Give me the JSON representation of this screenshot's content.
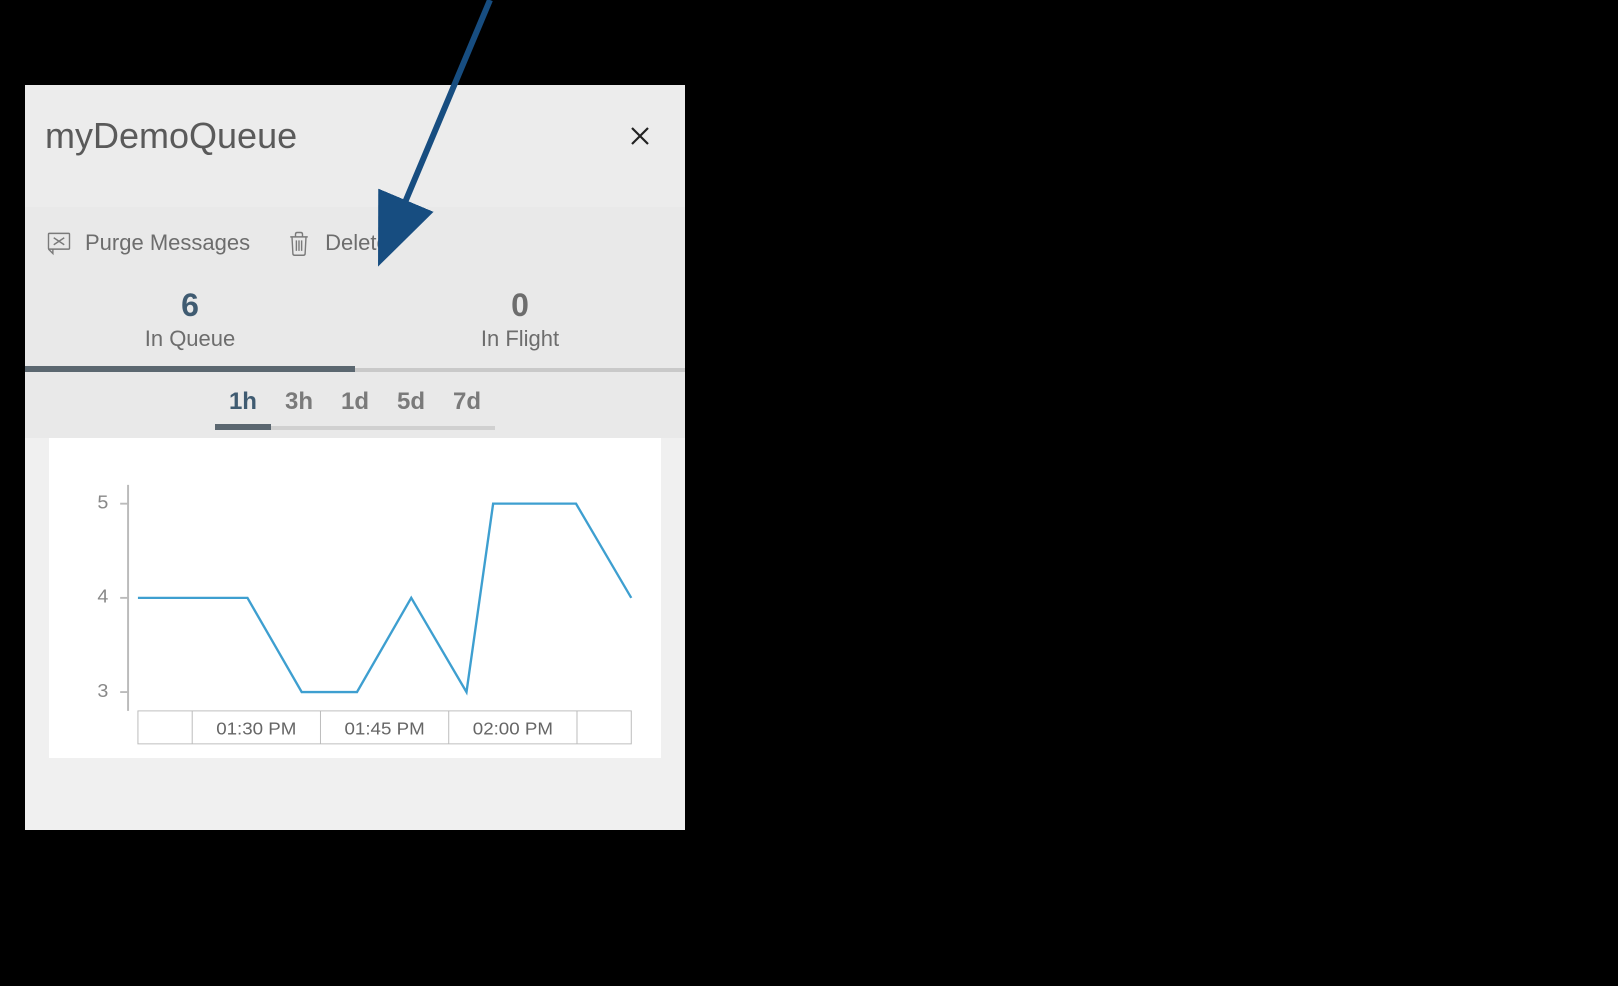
{
  "header": {
    "title": "myDemoQueue"
  },
  "actions": {
    "purge_label": "Purge Messages",
    "delete_label": "Delete"
  },
  "metrics": {
    "in_queue": {
      "value": "6",
      "label": "In Queue"
    },
    "in_flight": {
      "value": "0",
      "label": "In Flight"
    }
  },
  "time_tabs": [
    "1h",
    "3h",
    "1d",
    "5d",
    "7d"
  ],
  "time_tab_active": "1h",
  "chart_data": {
    "type": "line",
    "ylabel": "",
    "xlabel": "",
    "ylim": [
      3,
      5
    ],
    "y_ticks": [
      3,
      4,
      5
    ],
    "x_tick_labels": [
      "01:30 PM",
      "01:45 PM",
      "02:00 PM"
    ],
    "series": [
      {
        "name": "in_queue",
        "values": [
          4,
          4,
          4,
          3,
          3,
          4,
          3,
          5,
          5,
          4
        ]
      }
    ]
  },
  "annotation": {
    "arrow_target": "delete-button",
    "arrow_color": "#174d80"
  }
}
